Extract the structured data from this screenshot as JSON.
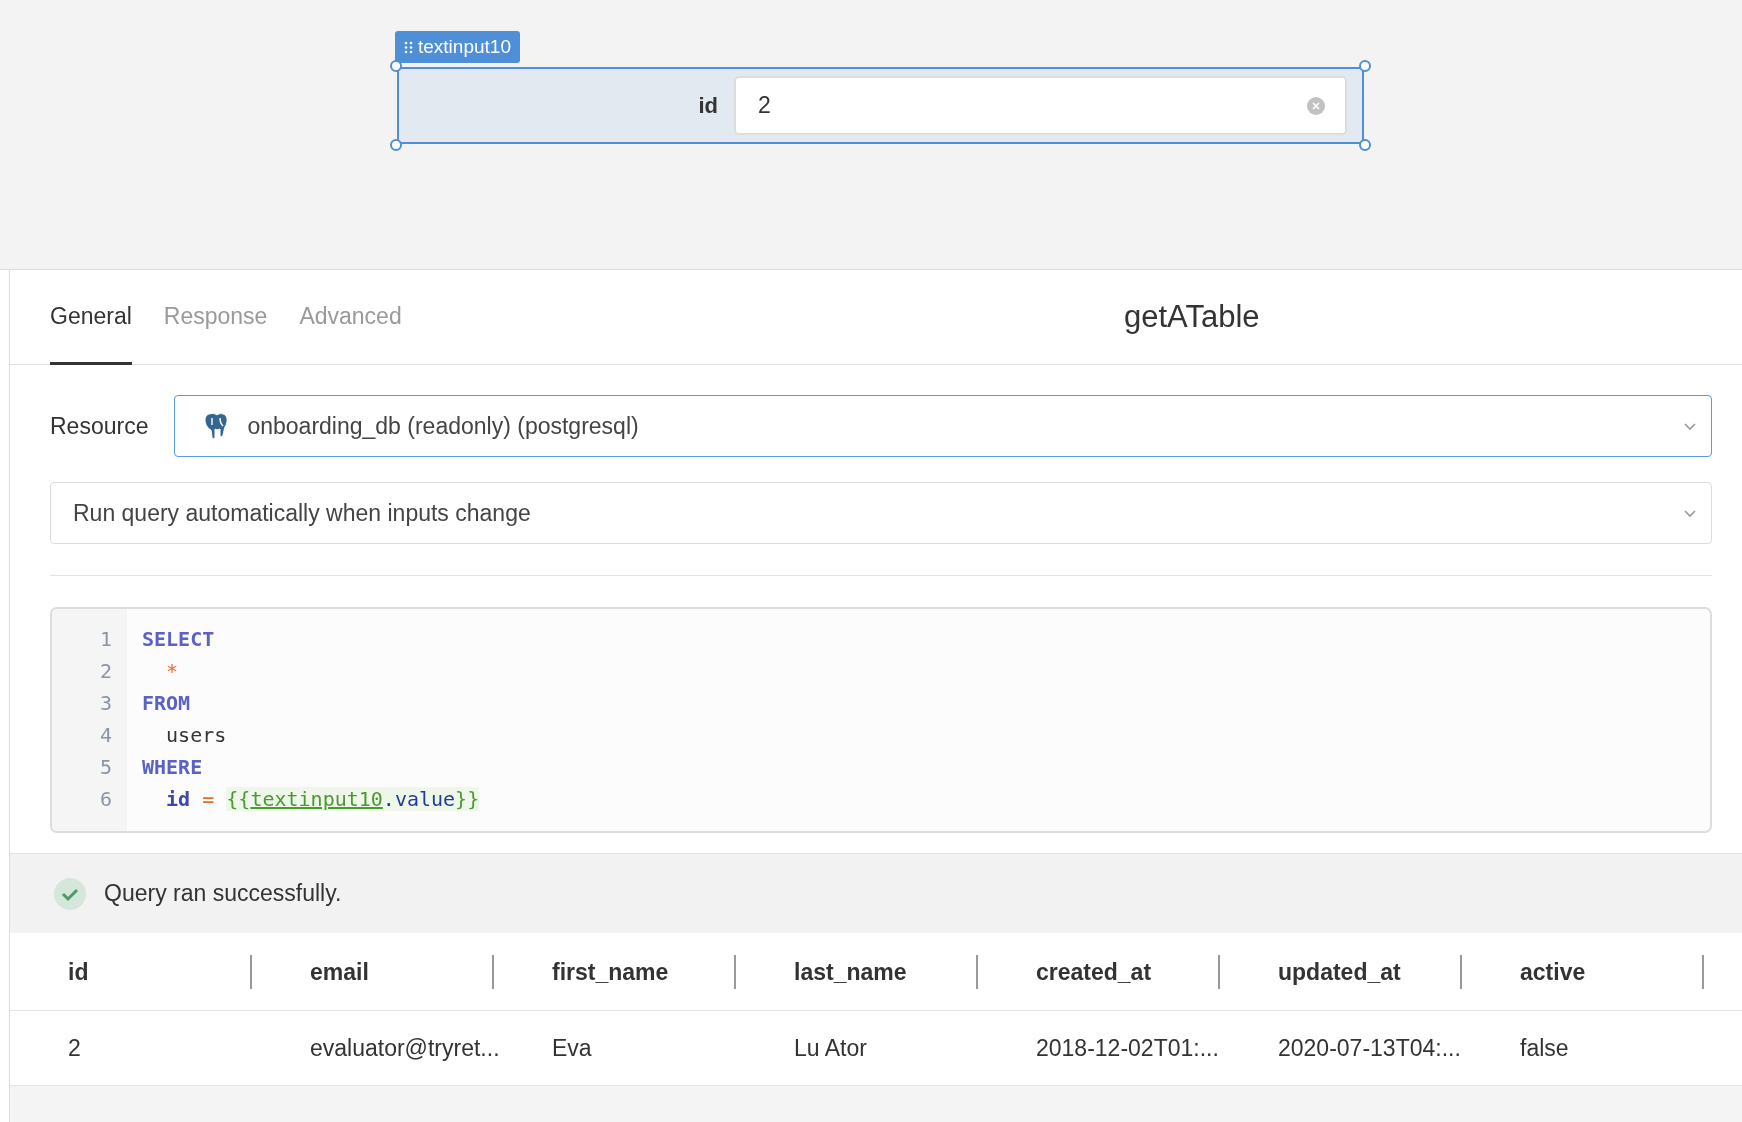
{
  "canvas": {
    "component": {
      "tag": "textinput10",
      "label": "id",
      "value": "2",
      "selected": true
    }
  },
  "query": {
    "tabs": [
      {
        "label": "General",
        "selected": true
      },
      {
        "label": "Response",
        "selected": false
      },
      {
        "label": "Advanced",
        "selected": false
      }
    ],
    "title": "getATable",
    "resource": {
      "label": "Resource",
      "value": "onboarding_db (readonly) (postgresql)"
    },
    "trigger": {
      "value": "Run query automatically when inputs change"
    },
    "code": [
      {
        "number": "1",
        "tokens": [
          {
            "kind": "keyword",
            "text": "SELECT"
          }
        ]
      },
      {
        "number": "2",
        "indent": true,
        "tokens": [
          {
            "kind": "operator",
            "text": "*"
          }
        ]
      },
      {
        "number": "3",
        "tokens": [
          {
            "kind": "keyword",
            "text": "FROM"
          }
        ]
      },
      {
        "number": "4",
        "indent": true,
        "tokens": [
          {
            "kind": "plain",
            "text": "users"
          }
        ]
      },
      {
        "number": "5",
        "tokens": [
          {
            "kind": "keyword",
            "text": "WHERE"
          }
        ]
      },
      {
        "number": "6",
        "indent": true,
        "tokens": [
          {
            "kind": "field",
            "text": "id"
          },
          {
            "kind": "operator",
            "text": " = "
          },
          {
            "kind": "brace",
            "text": "{{"
          },
          {
            "kind": "reference",
            "text": "textinput10"
          },
          {
            "kind": "property",
            "text": ".value"
          },
          {
            "kind": "brace",
            "text": "}}"
          }
        ]
      }
    ],
    "status": {
      "message": "Query ran successfully.",
      "success": true
    },
    "table": {
      "columns": [
        "id",
        "email",
        "first_name",
        "last_name",
        "created_at",
        "updated_at",
        "active"
      ],
      "rows": [
        [
          "2",
          "evaluator@tryret...",
          "Eva",
          "Lu Ator",
          "2018-12-02T01:...",
          "2020-07-13T04:...",
          "false"
        ]
      ]
    }
  }
}
